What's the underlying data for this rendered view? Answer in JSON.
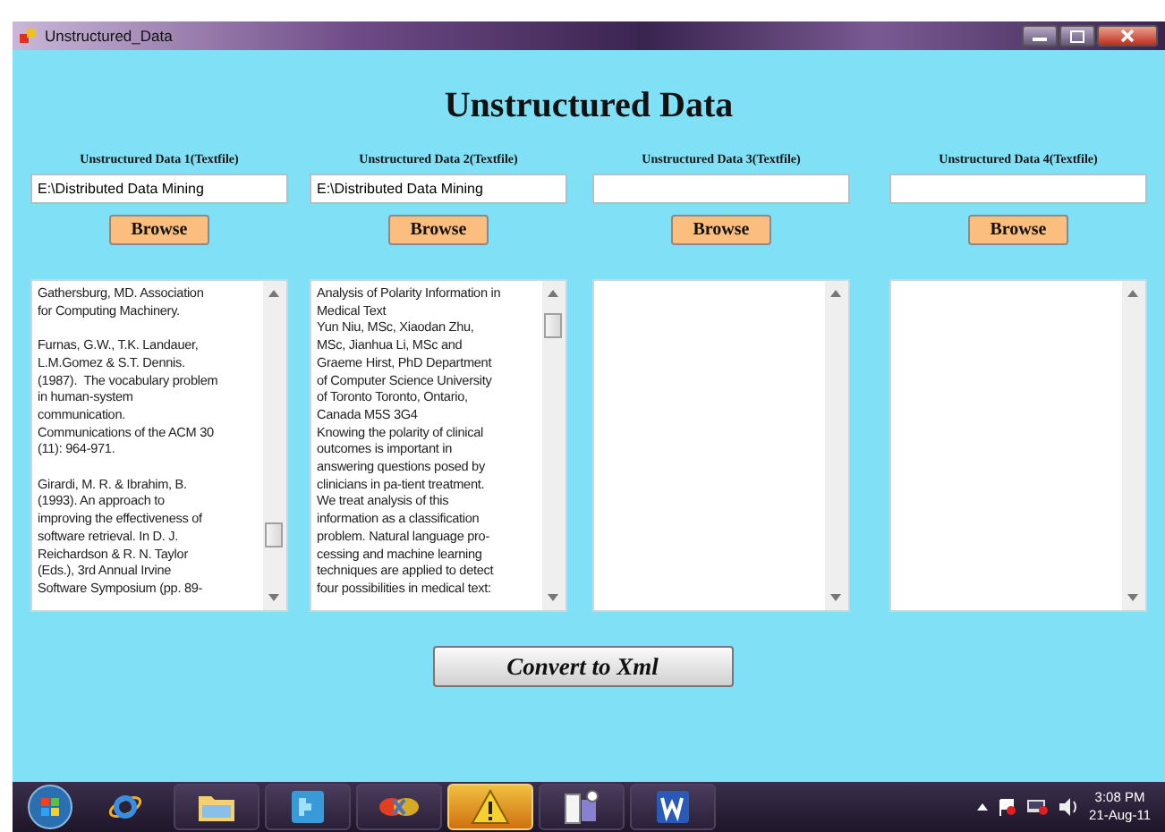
{
  "window": {
    "title": "Unstructured_Data"
  },
  "heading": "Unstructured Data",
  "inputs": [
    {
      "label": "Unstructured Data 1(Textfile)",
      "value": "E:\\Distributed Data Mining",
      "button": "Browse",
      "text": "Gathersburg, MD. Association\nfor Computing Machinery.\n\nFurnas, G.W., T.K. Landauer,\nL.M.Gomez & S.T. Dennis.\n(1987).  The vocabulary problem\nin human-system\ncommunication.\nCommunications of the ACM 30\n(11): 964-971.\n\nGirardi, M. R. & Ibrahim, B.\n(1993). An approach to\nimproving the effectiveness of\nsoftware retrieval. In D. J.\nReichardson & R. N. Taylor\n(Eds.), 3rd Annual Irvine\nSoftware Symposium (pp. 89-"
    },
    {
      "label": "Unstructured Data 2(Textfile)",
      "value": "E:\\Distributed Data Mining",
      "button": "Browse",
      "text": "Analysis of Polarity Information in\nMedical Text\nYun Niu, MSc, Xiaodan Zhu,\nMSc, Jianhua Li, MSc and\nGraeme Hirst, PhD Department\nof Computer Science University\nof Toronto Toronto, Ontario,\nCanada M5S 3G4\nKnowing the polarity of clinical\noutcomes is important in\nanswering questions posed by\nclinicians in pa-tient treatment.\nWe treat analysis of this\ninformation as a classification\nproblem. Natural language pro-\ncessing and machine learning\ntechniques are applied to detect\nfour possibilities in medical text:"
    },
    {
      "label": "Unstructured Data 3(Textfile)",
      "button": "Browse"
    },
    {
      "label": "Unstructured Data 4(Textfile)",
      "button": "Browse"
    }
  ],
  "convert_button": "Convert to Xml",
  "taskbar": {
    "items": [
      {
        "kind": "browser",
        "selected": false
      },
      {
        "kind": "folder",
        "selected": false
      },
      {
        "kind": "puzzle",
        "selected": false
      },
      {
        "kind": "shapes",
        "selected": false
      },
      {
        "kind": "warning",
        "selected": true
      },
      {
        "kind": "document",
        "selected": false
      },
      {
        "kind": "word",
        "selected": false
      }
    ],
    "time": "3:08 PM",
    "date": "21-Aug-11"
  }
}
